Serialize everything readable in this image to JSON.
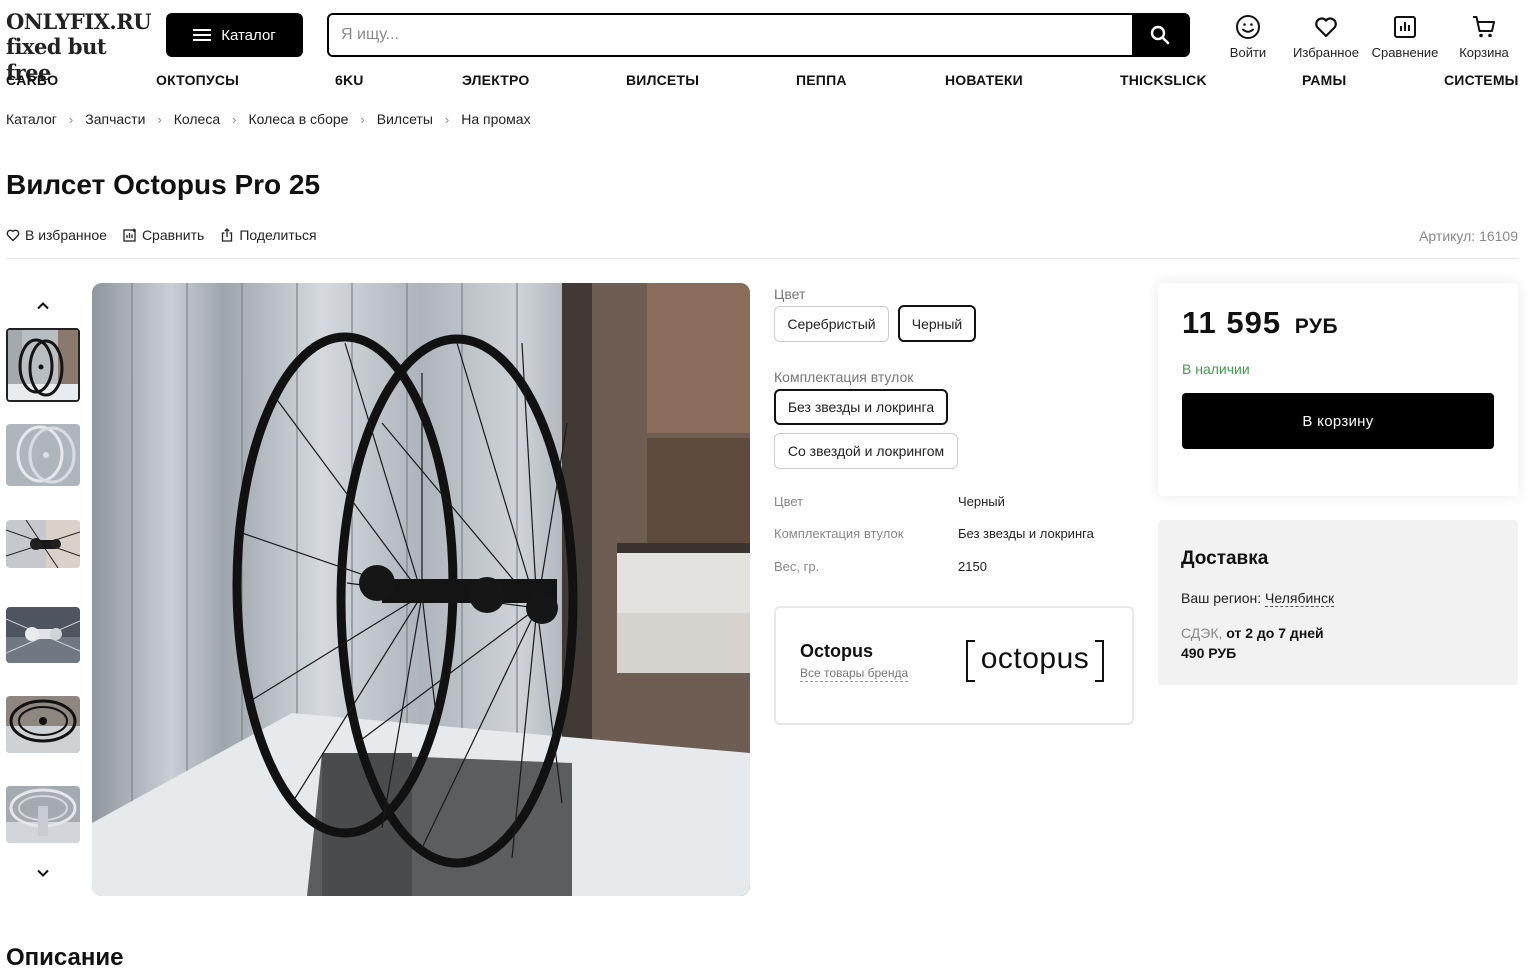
{
  "brand": {
    "line1": "ONLYFIX.RU",
    "line2": "fixed but free"
  },
  "header": {
    "catalog_label": "Каталог",
    "search_placeholder": "Я ищу...",
    "actions": {
      "login": "Войти",
      "favorites": "Избранное",
      "compare": "Сравнение",
      "cart": "Корзина"
    }
  },
  "nav": [
    "CARBO",
    "ОКТОПУСЫ",
    "6KU",
    "ЭЛЕКТРО",
    "ВИЛСЕТЫ",
    "ПЕППА",
    "НОВАТЕКИ",
    "THICKSLICK",
    "РАМЫ",
    "СИСТЕМЫ"
  ],
  "breadcrumbs": [
    "Каталог",
    "Запчасти",
    "Колеса",
    "Колеса в сборе",
    "Вилсеты",
    "На промах"
  ],
  "product": {
    "title": "Вилсет Octopus Pro 25",
    "actions": {
      "favorite": "В избранное",
      "compare": "Сравнить",
      "share": "Поделиться"
    },
    "article": "Артикул: 16109",
    "options": {
      "color_label": "Цвет",
      "colors": [
        "Серебристый",
        "Черный"
      ],
      "hub_label": "Комплектация втулок",
      "hubs": [
        "Без звезды и локринга",
        "Со звездой и локрингом"
      ]
    },
    "specs": [
      {
        "key": "Цвет",
        "value": "Черный"
      },
      {
        "key": "Комплектация втулок",
        "value": "Без звезды и локринга"
      },
      {
        "key": "Вес, гр.",
        "value": "2150"
      }
    ],
    "brand": {
      "name": "Octopus",
      "link": "Все товары бренда",
      "logo_text": "octopus"
    }
  },
  "price": {
    "amount": "11 595",
    "currency": "РУБ",
    "stock": "В наличии",
    "cart_button": "В корзину"
  },
  "delivery": {
    "title": "Доставка",
    "region_label": "Ваш регион:",
    "region": "Челябинск",
    "service": "СДЭК,",
    "days": "от 2 до 7 дней",
    "cost": "490 РУБ"
  },
  "description_title": "Описание",
  "colors": {
    "accent": "#000000",
    "stock": "#3f9d4a"
  }
}
